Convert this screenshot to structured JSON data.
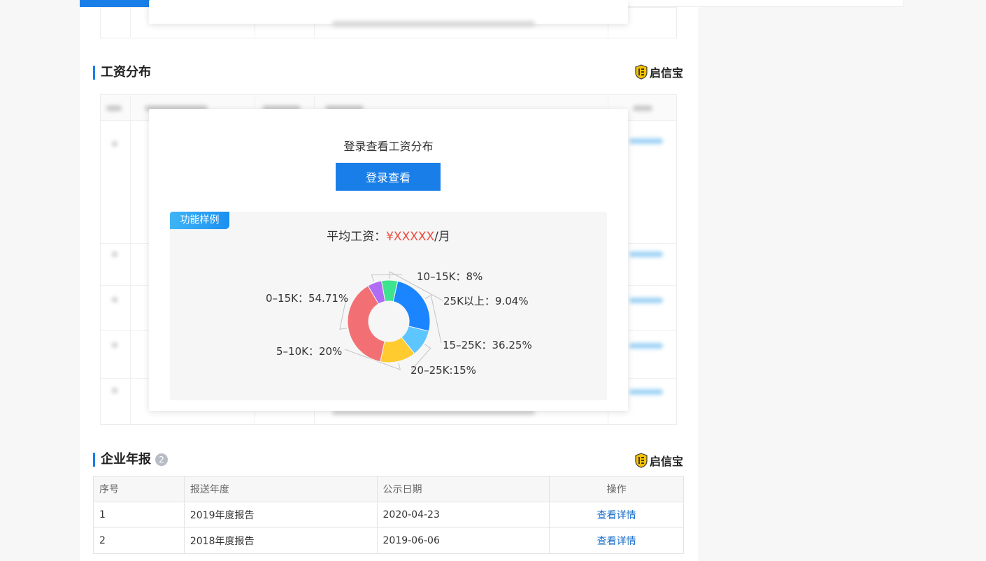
{
  "salary_section": {
    "title": "工资分布",
    "brand": "启信宝",
    "login_prompt": "登录查看工资分布",
    "login_button": "登录查看",
    "sample_tag": "功能样例",
    "avg_salary_label": "平均工资：",
    "avg_salary_value": "¥XXXXX",
    "avg_salary_unit": "/月"
  },
  "chart_data": {
    "type": "pie",
    "categories": [
      "0-15K",
      "10-15K",
      "25K以上",
      "15-25K",
      "20-25K",
      "5-10K"
    ],
    "values": [
      54.71,
      8,
      9.04,
      36.25,
      15,
      20
    ],
    "colors": [
      "#f27074",
      "#b06cf5",
      "#3ee38f",
      "#1a85ff",
      "#5ec6ff",
      "#ffcb2f"
    ],
    "labels": [
      "0–15K：54.71%",
      "10–15K：8%",
      "25K以上：9.04%",
      "15–25K：36.25%",
      "20–25K:15%",
      "5–10K：20%"
    ],
    "donut": true
  },
  "report_section": {
    "title": "企业年报",
    "count": "2",
    "brand": "启信宝",
    "columns": [
      "序号",
      "报送年度",
      "公示日期",
      "操作"
    ],
    "rows": [
      {
        "index": "1",
        "year": "2019年度报告",
        "date": "2020-04-23",
        "action": "查看详情"
      },
      {
        "index": "2",
        "year": "2018年度报告",
        "date": "2019-06-06",
        "action": "查看详情"
      }
    ]
  },
  "colors": {
    "accent": "#1a7ee8",
    "link": "#1a6fc8",
    "highlight_red": "#f04a3c"
  }
}
